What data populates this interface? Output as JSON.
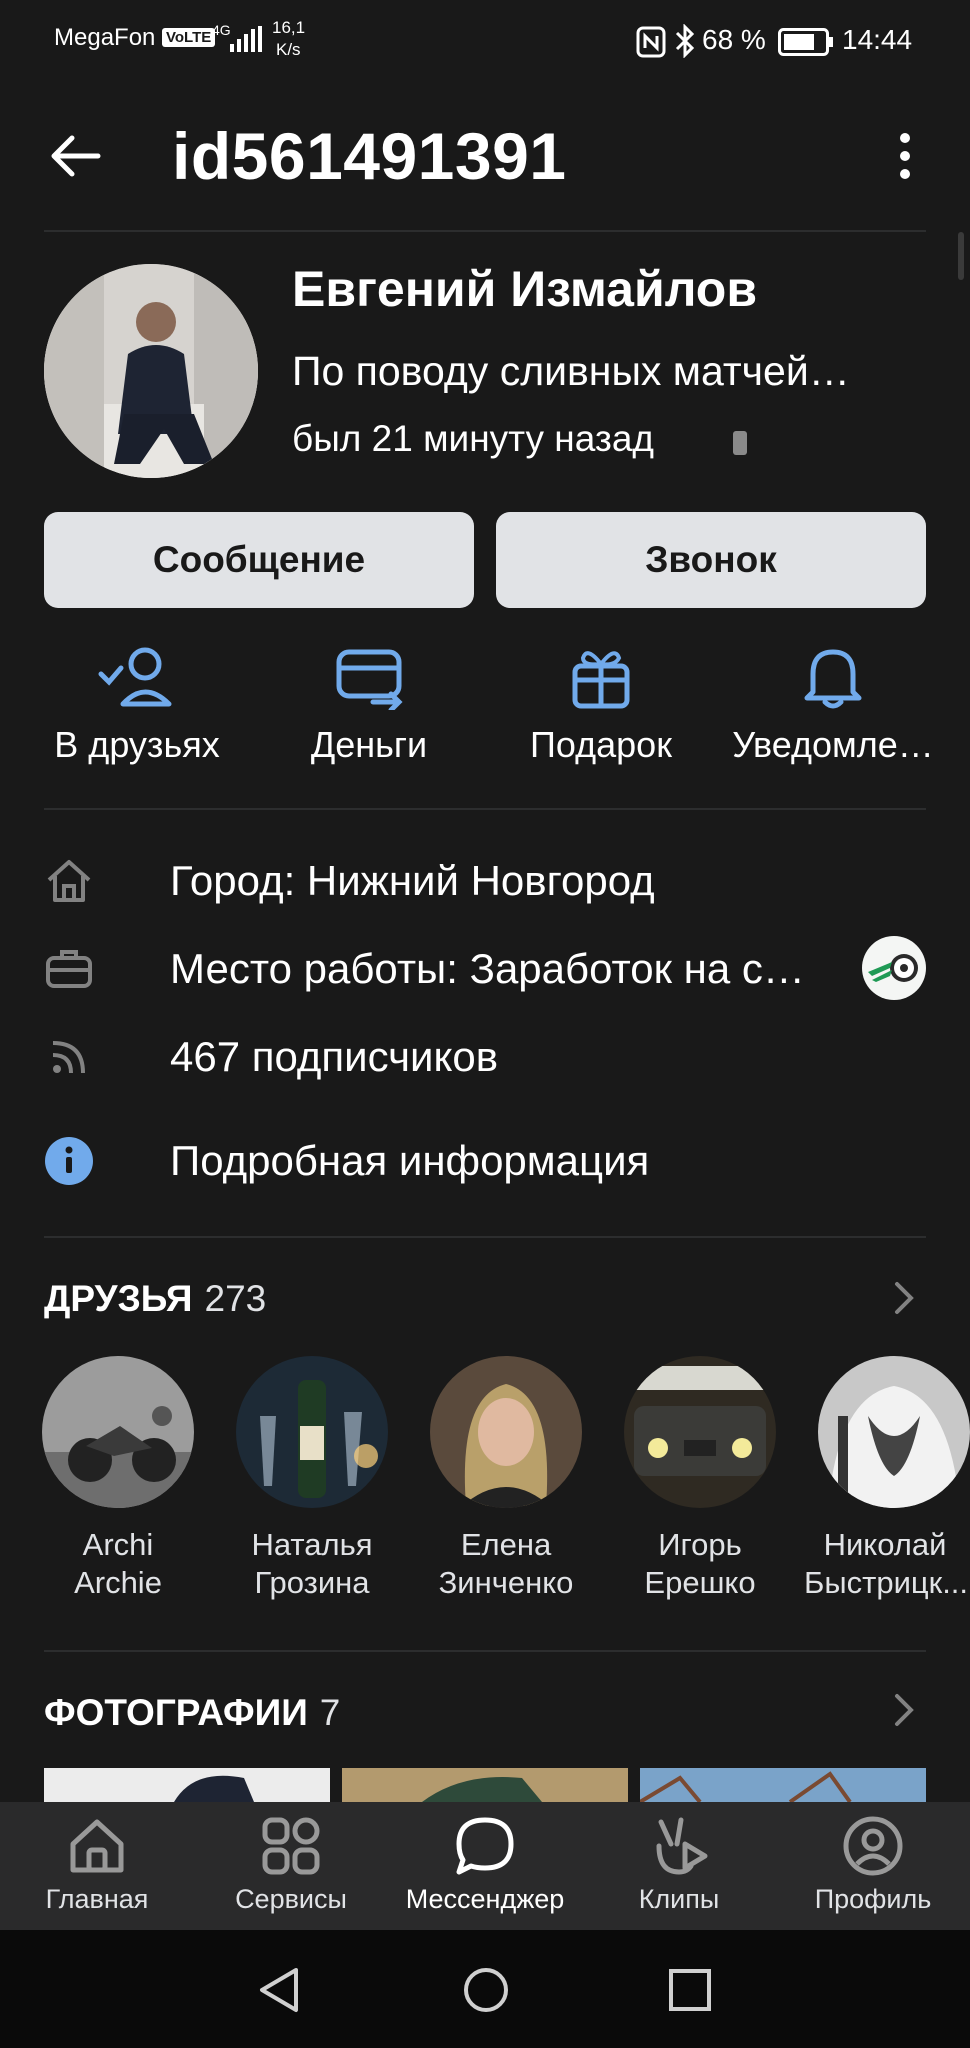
{
  "status_bar": {
    "carrier": "MegaFon",
    "volte": "VoLTE",
    "network": "4G",
    "speed_value": "16,1",
    "speed_unit": "K/s",
    "battery": "68 %",
    "time": "14:44"
  },
  "header": {
    "title": "id561491391"
  },
  "profile": {
    "name": "Евгений Измайлов",
    "status": "По поводу сливных матчей…",
    "last_seen": "был 21 минуту назад"
  },
  "buttons": {
    "message": "Сообщение",
    "call": "Звонок"
  },
  "actions": [
    {
      "label": "В друзьях",
      "icon": "friend-check-icon"
    },
    {
      "label": "Деньги",
      "icon": "money-transfer-icon"
    },
    {
      "label": "Подарок",
      "icon": "gift-icon"
    },
    {
      "label": "Уведомле…",
      "icon": "bell-icon"
    }
  ],
  "info": {
    "city": "Город: Нижний Новгород",
    "work": "Место работы: Заработок на с…",
    "followers": "467 подписчиков",
    "details": "Подробная информация"
  },
  "friends": {
    "title": "ДРУЗЬЯ",
    "count": "273",
    "items": [
      {
        "line1": "Archi",
        "line2": "Archie"
      },
      {
        "line1": "Наталья",
        "line2": "Грозина"
      },
      {
        "line1": "Елена",
        "line2": "Зинченко"
      },
      {
        "line1": "Игорь",
        "line2": "Ерешко"
      },
      {
        "line1": "Николай",
        "line2": "Быстрицк..."
      }
    ]
  },
  "photos": {
    "title": "ФОТОГРАФИИ",
    "count": "7"
  },
  "tabbar": {
    "items": [
      {
        "label": "Главная",
        "icon": "home-icon"
      },
      {
        "label": "Сервисы",
        "icon": "services-icon"
      },
      {
        "label": "Мессенджер",
        "icon": "messenger-icon"
      },
      {
        "label": "Клипы",
        "icon": "clips-icon"
      },
      {
        "label": "Профиль",
        "icon": "profile-icon"
      }
    ]
  },
  "colors": {
    "background": "#191919",
    "accent": "#71aaeb",
    "button_bg": "#e1e3e6",
    "tabbar_bg": "#2a2a2b"
  }
}
